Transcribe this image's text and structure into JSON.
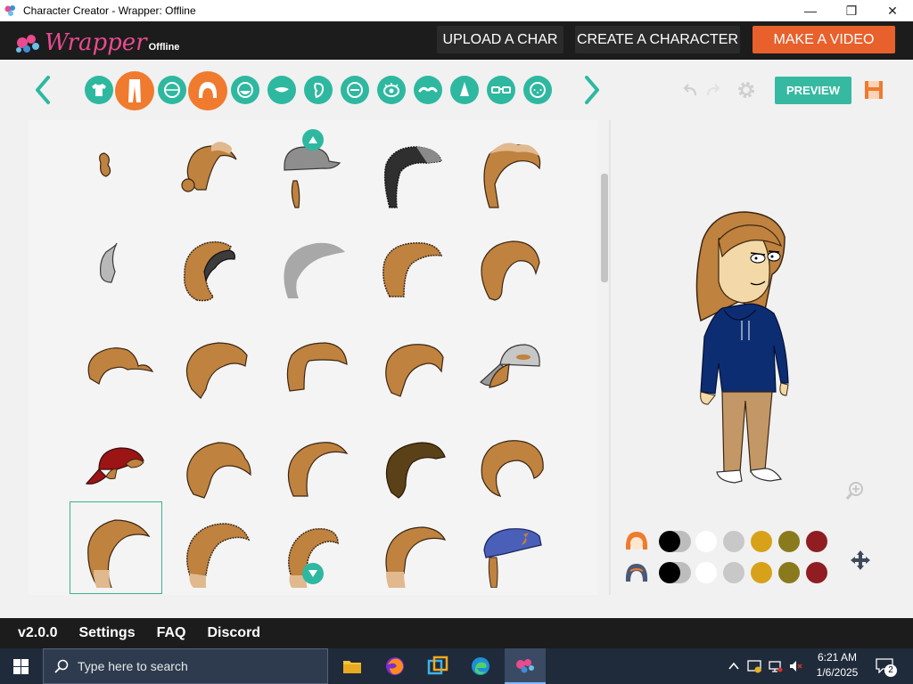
{
  "window": {
    "title": "Character Creator - Wrapper: Offline",
    "controls": {
      "minimize": "—",
      "restore": "❐",
      "close": "✕"
    }
  },
  "header": {
    "logo": {
      "main": "Wrapper",
      "sub": "Offline"
    },
    "buttons": {
      "upload": "UPLOAD A CHAR",
      "create": "CREATE A CHARACTER",
      "make_video": "MAKE A VIDEO"
    },
    "accent_color": "#e8602c"
  },
  "toolbar": {
    "categories": [
      {
        "name": "upper-body",
        "icon": "shirt-icon"
      },
      {
        "name": "lower-body",
        "icon": "pants-icon",
        "active": true
      },
      {
        "name": "face-shape",
        "icon": "face-outline-icon"
      },
      {
        "name": "hair",
        "icon": "hair-icon",
        "active": true
      },
      {
        "name": "beard",
        "icon": "beard-icon"
      },
      {
        "name": "mouth",
        "icon": "mouth-icon"
      },
      {
        "name": "ear",
        "icon": "ear-icon"
      },
      {
        "name": "facial-detail",
        "icon": "face-detail-icon"
      },
      {
        "name": "eyes",
        "icon": "eye-icon"
      },
      {
        "name": "eyebrows",
        "icon": "eyebrow-icon"
      },
      {
        "name": "nose",
        "icon": "nose-icon"
      },
      {
        "name": "glasses",
        "icon": "glasses-icon"
      },
      {
        "name": "freckles",
        "icon": "freckles-icon"
      }
    ],
    "preview_label": "PREVIEW",
    "theme_color": "#2eb8a0",
    "active_color": "#f07a2e"
  },
  "hair_grid": {
    "item_count": 25,
    "selected_index": 20
  },
  "colors": {
    "rows": [
      {
        "icon": "hair-color-icon",
        "swatches": [
          "#000000",
          "#ffffff",
          "#c8c8c8",
          "#d8a11a",
          "#8a7a1d",
          "#8f1d22"
        ]
      },
      {
        "icon": "hair-color-icon-secondary",
        "swatches": [
          "#000000",
          "#ffffff",
          "#c8c8c8",
          "#d8a11a",
          "#8a7a1d",
          "#8f1d22"
        ]
      }
    ]
  },
  "footer": {
    "version": "v2.0.0",
    "links": [
      "Settings",
      "FAQ",
      "Discord"
    ]
  },
  "taskbar": {
    "search_placeholder": "Type here to search",
    "time": "6:21 AM",
    "date": "1/6/2025",
    "notifications": "2"
  }
}
